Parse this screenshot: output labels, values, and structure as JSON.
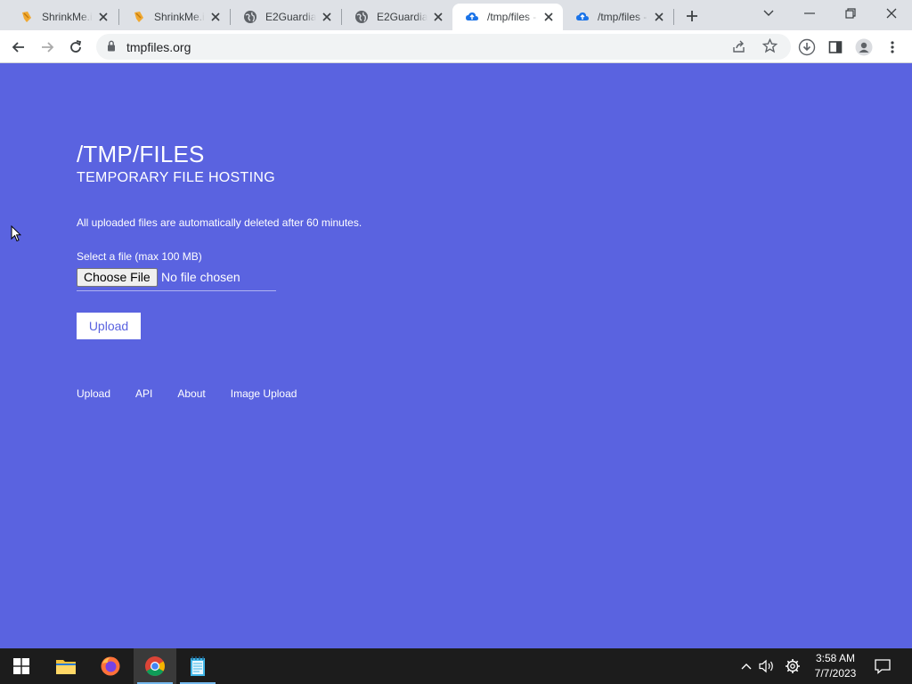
{
  "browser": {
    "tabs": [
      {
        "title": "ShrinkMe.io",
        "icon": "shrinkme-icon",
        "active": false
      },
      {
        "title": "ShrinkMe.io",
        "icon": "shrinkme-icon",
        "active": false
      },
      {
        "title": "E2Guardian",
        "icon": "globe-icon",
        "active": false
      },
      {
        "title": "E2Guardian",
        "icon": "globe-icon",
        "active": false
      },
      {
        "title": "/tmp/files - ",
        "icon": "cloud-upload-icon",
        "active": true
      },
      {
        "title": "/tmp/files - ",
        "icon": "cloud-upload-icon",
        "active": false
      }
    ],
    "url": "tmpfiles.org"
  },
  "page": {
    "title": "/TMP/FILES",
    "subtitle": "TEMPORARY FILE HOSTING",
    "notice": "All uploaded files are automatically deleted after 60 minutes.",
    "file_label": "Select a file (max 100 MB)",
    "choose_file": "Choose File",
    "no_file": "No file chosen",
    "upload": "Upload",
    "footer_links": [
      "Upload",
      "API",
      "About",
      "Image Upload"
    ]
  },
  "taskbar": {
    "time": "3:58 AM",
    "date": "7/7/2023"
  },
  "colors": {
    "page_bg": "#5a63e0",
    "accent": "#1a73e8"
  }
}
